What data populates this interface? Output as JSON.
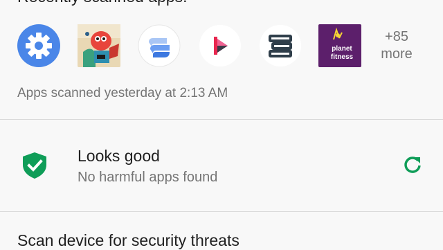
{
  "recent": {
    "title": "Recently scanned apps:",
    "apps": [
      {
        "icon": "settings-gear-icon"
      },
      {
        "icon": "game-character-icon"
      },
      {
        "icon": "layers-app-icon"
      },
      {
        "icon": "red-play-app-icon"
      },
      {
        "icon": "stacked-bars-app-icon"
      },
      {
        "icon": "planet-fitness-icon",
        "label_line1": "planet",
        "label_line2": "fitness"
      }
    ],
    "more_count": "+85",
    "more_label": "more",
    "scan_time": "Apps scanned yesterday at 2:13 AM"
  },
  "status": {
    "title": "Looks good",
    "subtitle": "No harmful apps found",
    "icon": "shield-check-icon",
    "refresh_icon": "refresh-icon",
    "accent": "#0f9d58"
  },
  "scan_option": {
    "label": "Scan device for security threats"
  }
}
